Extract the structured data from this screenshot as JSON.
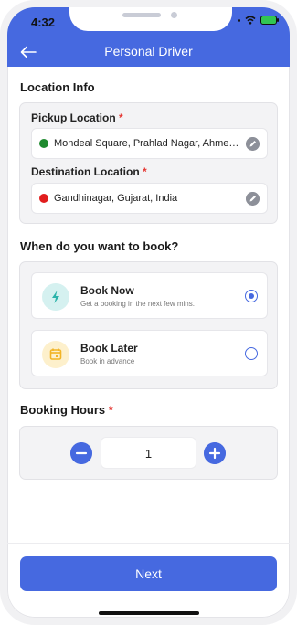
{
  "status_bar": {
    "time": "4:32"
  },
  "header": {
    "title": "Personal Driver",
    "back_icon": "arrow-left-icon"
  },
  "location": {
    "section_title": "Location Info",
    "pickup": {
      "label": "Pickup Location",
      "required_mark": "*",
      "value": "Mondeal Square, Prahlad Nagar, Ahmedabad, Gujarat, India",
      "dot_color": "#1e8a2e"
    },
    "destination": {
      "label": "Destination Location",
      "required_mark": "*",
      "value": "Gandhinagar, Gujarat, India",
      "dot_color": "#e11d1d"
    }
  },
  "booking": {
    "section_title": "When do you want to book?",
    "options": [
      {
        "title": "Book Now",
        "subtitle": "Get a booking in the next few mins.",
        "icon": "lightning-icon",
        "icon_bg": "#d5f1f0",
        "icon_color": "#2bb3aa",
        "selected": true
      },
      {
        "title": "Book Later",
        "subtitle": "Book in advance",
        "icon": "calendar-icon",
        "icon_bg": "#fdf0cc",
        "icon_color": "#f2b425",
        "selected": false
      }
    ]
  },
  "hours": {
    "section_title": "Booking Hours",
    "required_mark": "*",
    "value": "1"
  },
  "footer": {
    "next_label": "Next"
  },
  "colors": {
    "accent": "#4669e0",
    "required": "#e53935"
  }
}
